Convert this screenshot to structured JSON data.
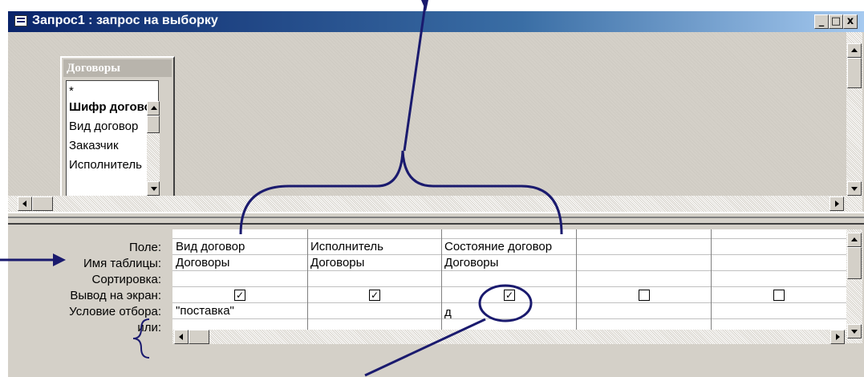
{
  "window": {
    "title": "Запрос1 : запрос на выборку",
    "controls": {
      "minimize": "_",
      "maximize": "□",
      "close": "x"
    }
  },
  "table_box": {
    "title": "Договоры",
    "fields": [
      "*",
      "Шифр догово",
      "Вид договор",
      "Заказчик",
      "Исполнитель"
    ],
    "bold_field_index": 1
  },
  "grid": {
    "row_labels": [
      "Поле:",
      "Имя таблицы:",
      "Сортировка:",
      "Вывод на экран:",
      "Условие отбора:",
      "или:"
    ],
    "columns": [
      {
        "field": "Вид договор",
        "table": "Договоры",
        "sort": "",
        "show": true,
        "criteria": "\"поставка\"",
        "or": ""
      },
      {
        "field": "Исполнитель",
        "table": "Договоры",
        "sort": "",
        "show": true,
        "criteria": "",
        "or": ""
      },
      {
        "field": "Состояние договор",
        "table": "Договоры",
        "sort": "",
        "show": true,
        "criteria": "д",
        "or": ""
      },
      {
        "field": "",
        "table": "",
        "sort": "",
        "show": false,
        "criteria": "",
        "or": ""
      },
      {
        "field": "",
        "table": "",
        "sort": "",
        "show": false,
        "criteria": "",
        "or": ""
      }
    ],
    "checkmark": "✓"
  },
  "colors": {
    "annotation": "#1a1a6e",
    "titlebar_start": "#0a246a",
    "face": "#d4d0c8"
  },
  "icons": [
    "app-icon",
    "scroll-up-icon",
    "scroll-down-icon",
    "scroll-left-icon",
    "scroll-right-icon"
  ]
}
